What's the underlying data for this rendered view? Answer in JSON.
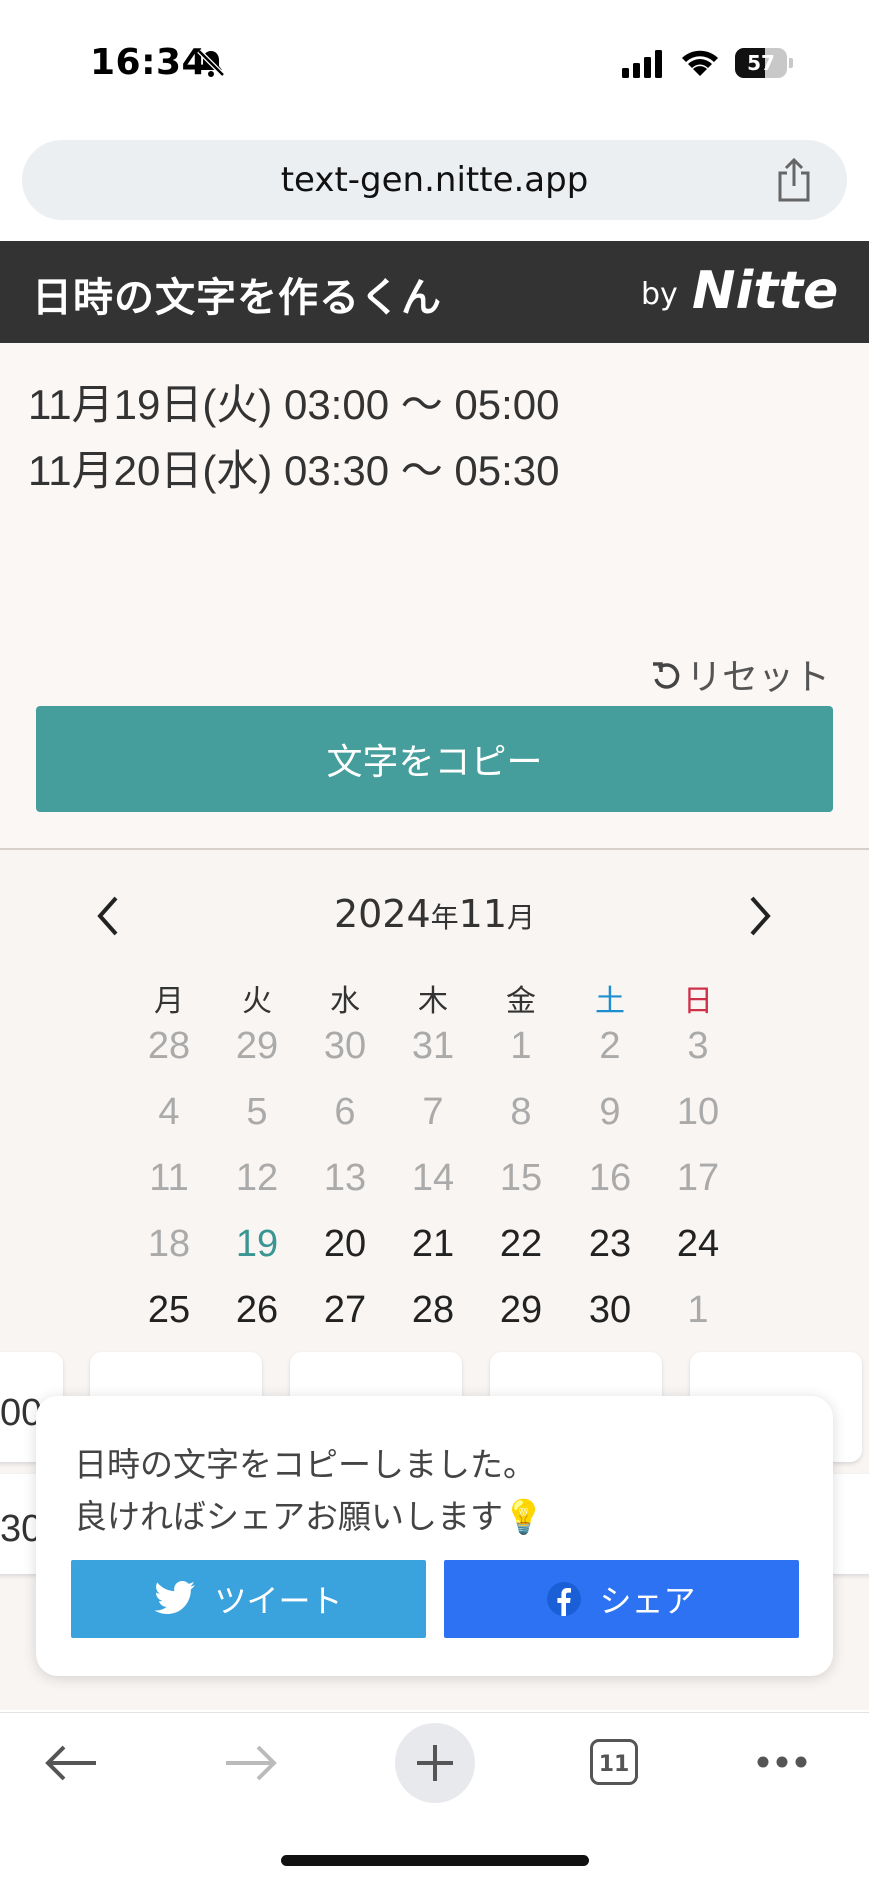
{
  "status_bar": {
    "time": "16:34",
    "battery": "57",
    "battery_level": 0.57
  },
  "browser": {
    "url": "text-gen.nitte.app"
  },
  "header": {
    "title": "日時の文字を作るくん",
    "by": "by",
    "brand": "Nitte"
  },
  "output": {
    "lines": [
      "11月19日(火) 03:00 〜 05:00",
      "11月20日(水) 03:30 〜 05:30"
    ],
    "reset_label": "リセット",
    "copy_label": "文字をコピー"
  },
  "calendar": {
    "year": "2024",
    "year_suffix": "年",
    "month": "11",
    "month_suffix": "月",
    "weekdays": [
      "月",
      "火",
      "水",
      "木",
      "金",
      "土",
      "日"
    ],
    "colors": {
      "saturday": "#1e8ecf",
      "sunday": "#d0314a",
      "selected_bg": "#c9e8e6",
      "accent": "#469e9c"
    },
    "weeks": [
      [
        "28",
        "29",
        "30",
        "31",
        "1",
        "2",
        "3"
      ],
      [
        "4",
        "5",
        "6",
        "7",
        "8",
        "9",
        "10"
      ],
      [
        "11",
        "12",
        "13",
        "14",
        "15",
        "16",
        "17"
      ],
      [
        "18",
        "19",
        "20",
        "21",
        "22",
        "23",
        "24"
      ],
      [
        "25",
        "26",
        "27",
        "28",
        "29",
        "30",
        "1"
      ]
    ],
    "selected_day": "19"
  },
  "slots": {
    "row1_partial": "00",
    "row2_partial": "30"
  },
  "share_popup": {
    "message_line1": "日時の文字をコピーしました。",
    "message_line2": "良ければシェアお願いします💡",
    "tweet_label": "ツイート",
    "share_label": "シェア",
    "twitter_color": "#3aa3dd",
    "facebook_color": "#2d72f3"
  },
  "toolbar": {
    "tabs_count": "11"
  }
}
